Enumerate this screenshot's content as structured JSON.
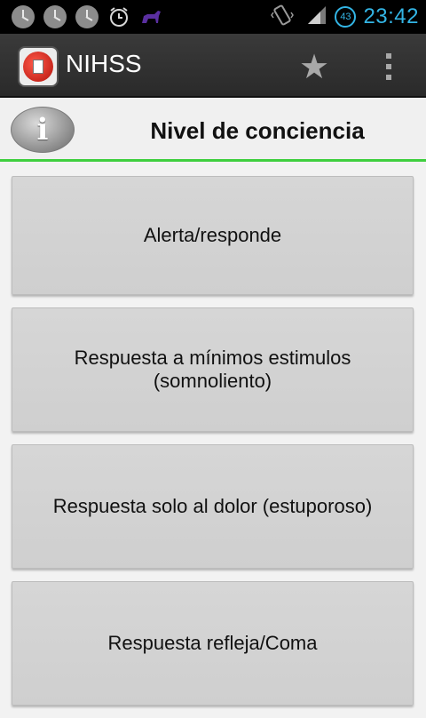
{
  "status_bar": {
    "time": "23:42",
    "battery_level": "43",
    "icons": [
      "clock-icon",
      "clock-icon",
      "clock-icon",
      "alarm-icon",
      "dog-icon",
      "vibrate-icon",
      "signal-icon",
      "battery-icon"
    ]
  },
  "action_bar": {
    "title": "NIHSS",
    "favorite_icon": "star-icon",
    "overflow_icon": "overflow-menu-icon"
  },
  "header": {
    "info_icon": "info-icon",
    "title": "Nivel de conciencia",
    "accent_color": "#3fcf3f"
  },
  "options": [
    {
      "label": "Alerta/responde"
    },
    {
      "label": "Respuesta a mínimos estimulos (somnoliento)"
    },
    {
      "label": "Respuesta solo al dolor (estuporoso)"
    },
    {
      "label": "Respuesta refleja/Coma"
    }
  ]
}
